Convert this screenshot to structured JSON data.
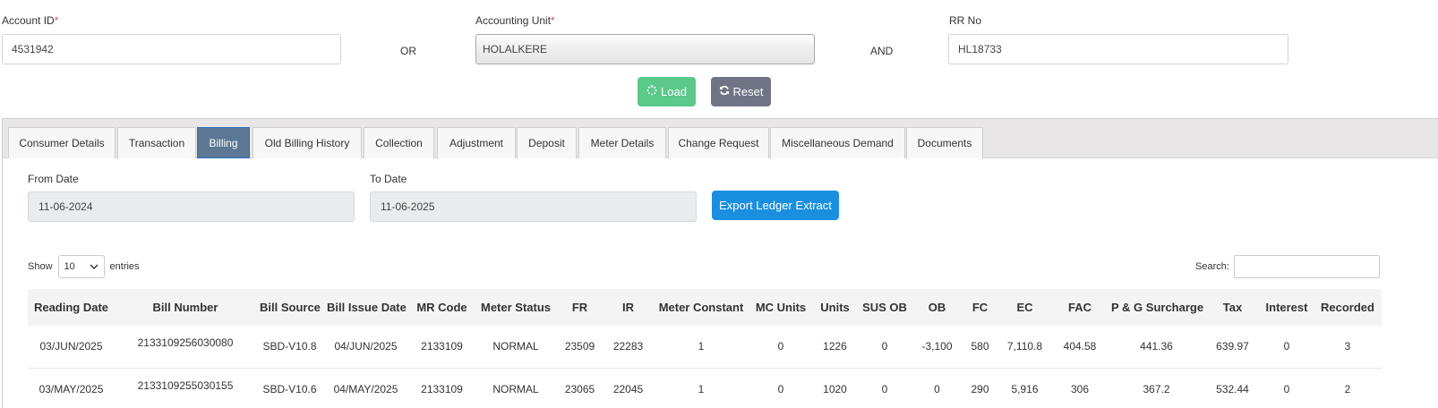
{
  "filters": {
    "account_id": {
      "label": "Account ID",
      "required": "*",
      "value": "4531942"
    },
    "or": "OR",
    "accounting_unit": {
      "label": "Accounting Unit",
      "required": "*",
      "value": "HOLALKERE"
    },
    "and": "AND",
    "rr_no": {
      "label": "RR No",
      "value": "HL18733"
    }
  },
  "actions": {
    "load": "Load",
    "reset": "Reset"
  },
  "tabs": [
    "Consumer Details",
    "Transaction",
    "Billing",
    "Old Billing History",
    "Collection",
    "Adjustment",
    "Deposit",
    "Meter Details",
    "Change Request",
    "Miscellaneous Demand",
    "Documents"
  ],
  "active_tab": "Billing",
  "billing": {
    "from_date": {
      "label": "From Date",
      "value": "11-06-2024"
    },
    "to_date": {
      "label": "To Date",
      "value": "11-06-2025"
    },
    "export_label": "Export Ledger Extract",
    "show_label": "Show",
    "entries_value": "10",
    "entries_label": "entries",
    "search_label": "Search:"
  },
  "table": {
    "columns": [
      "Reading Date",
      "Bill Number",
      "Bill Source",
      "Bill Issue Date",
      "MR Code",
      "Meter Status",
      "FR",
      "IR",
      "Meter Constant",
      "MC Units",
      "Units",
      "SUS OB",
      "OB",
      "FC",
      "EC",
      "FAC",
      "P & G Surcharge",
      "Tax",
      "Interest",
      "Recorded"
    ],
    "rows": [
      [
        "03/JUN/2025",
        "2133109256030080",
        "SBD-V10.8",
        "04/JUN/2025",
        "2133109",
        "NORMAL",
        "23509",
        "22283",
        "1",
        "0",
        "1226",
        "0",
        "-3,100",
        "580",
        "7,110.8",
        "404.58",
        "441.36",
        "639.97",
        "0",
        "3"
      ],
      [
        "03/MAY/2025",
        "2133109255030155",
        "SBD-V10.6",
        "04/MAY/2025",
        "2133109",
        "NORMAL",
        "23065",
        "22045",
        "1",
        "0",
        "1020",
        "0",
        "0",
        "290",
        "5,916",
        "306",
        "367.2",
        "532.44",
        "0",
        "2"
      ]
    ]
  }
}
